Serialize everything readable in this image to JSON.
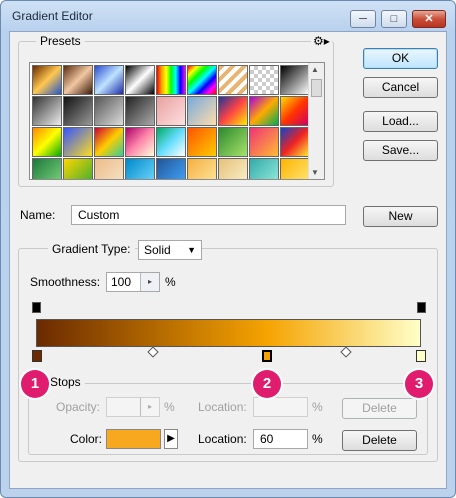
{
  "window": {
    "title": "Gradient Editor",
    "minimize_label": "─",
    "maximize_label": "□",
    "close_label": "✕"
  },
  "buttons": {
    "ok": "OK",
    "cancel": "Cancel",
    "load": "Load...",
    "save": "Save...",
    "new": "New",
    "delete_opacity": "Delete",
    "delete_color": "Delete"
  },
  "presets": {
    "label": "Presets",
    "menu_icon": "gear-icon",
    "swatches": [
      "linear-gradient(135deg,#6b2a00,#ffc850,#2255cc)",
      "linear-gradient(135deg,#5a2d10,#f2c7a2,#3a1a0a)",
      "linear-gradient(135deg,#2a4ed0,#bfe3ff,#1b2aa8)",
      "linear-gradient(135deg,#000,#fff,#000)",
      "linear-gradient(90deg,red,orange,yellow,lime,cyan,blue,magenta)",
      "linear-gradient(135deg,red,yellow,lime,cyan,blue,magenta,red)",
      "repeating-linear-gradient(135deg,#e8b470 0 4px,#fff 4px 8px)",
      "repeating-conic-gradient(#ccc 0 25%,#fff 0 50%) 0 0/8px 8px",
      "linear-gradient(135deg,#000,#fff)",
      "linear-gradient(135deg,#333,#eee)",
      "linear-gradient(135deg,#111,#999)",
      "linear-gradient(135deg,#555,#ddd)",
      "linear-gradient(135deg,#222,#aaa)",
      "linear-gradient(135deg,#e8a0a0,#ffe0e0)",
      "linear-gradient(135deg,#7ad,#fda)",
      "linear-gradient(135deg,#223399,#ff4444,#ffee00)",
      "linear-gradient(135deg,#a0d,#fa0,#0a5)",
      "linear-gradient(135deg,#ffdd00,#ff3300,#cc0066)",
      "linear-gradient(135deg,#f80,#ff0,#0a0)",
      "linear-gradient(135deg,#3355ff,#ffdd22)",
      "linear-gradient(135deg,#c03,#fc0,#3c9)",
      "linear-gradient(135deg,#a06,#f8a,#ffd)",
      "linear-gradient(135deg,#0a6,#6df,#fff)",
      "linear-gradient(135deg,#ff5500,#ffcc00)",
      "linear-gradient(135deg,#2d8a2d,#a6e26b)",
      "linear-gradient(135deg,#ee3377,#ffbb33)",
      "linear-gradient(135deg,#1144cc,#ee2222,#ffee33)",
      "linear-gradient(135deg,#1b7a3a,#82d680)",
      "linear-gradient(135deg,#ffd600,#33aa33)",
      "linear-gradient(135deg,#eebb88,#f5e6cc)",
      "linear-gradient(135deg,#0088cc,#77ddff)",
      "linear-gradient(135deg,#225599,#44aaff)",
      "linear-gradient(135deg,#f5b040,#ffe8a0)",
      "linear-gradient(135deg,#e6c07a,#fdf3d0)",
      "linear-gradient(135deg,#3aa,#9ed)",
      "linear-gradient(135deg,#ffb300,#ffea80)",
      "linear-gradient(135deg,#e59a3a,#ffd280)",
      "linear-gradient(135deg,#77aa55,#ccee99)",
      "linear-gradient(135deg,#ffbb55,#ffeecc)",
      "linear-gradient(135deg,#2a8,#8fd)"
    ]
  },
  "name": {
    "label": "Name:",
    "value": "Custom"
  },
  "gradient": {
    "type_label": "Gradient Type:",
    "type_value": "Solid",
    "smoothness_label": "Smoothness:",
    "smoothness_value": "100",
    "percent": "%",
    "colors": {
      "start": "#6b2a00",
      "mid": "#f5a300",
      "end": "#ffffc8"
    }
  },
  "stops": {
    "label": "Stops",
    "opacity_label": "Opacity:",
    "opacity_value": "",
    "opacity_percent": "%",
    "opacity_location_label": "Location:",
    "opacity_location_value": "",
    "opacity_location_percent": "%",
    "color_label": "Color:",
    "color_value": "#f7a81e",
    "color_location_label": "Location:",
    "color_location_value": "60",
    "color_location_percent": "%"
  },
  "markers": [
    "1",
    "2",
    "3"
  ],
  "accent": "#e01c6f"
}
